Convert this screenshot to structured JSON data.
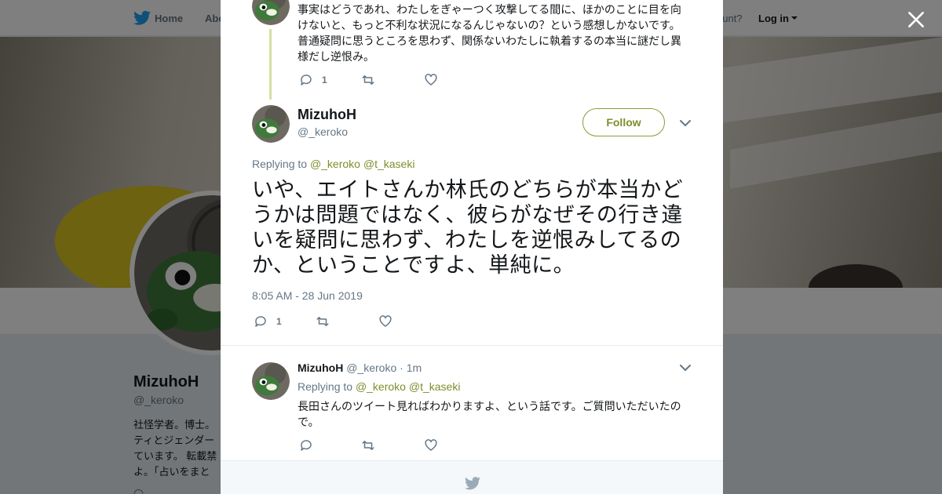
{
  "nav": {
    "home": "Home",
    "about": "Abo",
    "account_prompt": "ccount?",
    "login": "Log in"
  },
  "profile": {
    "name": "MizuhoH",
    "handle": "@_keroko",
    "bio": "社怪学者。博士。ティとジェンダーています。 転載禁よ。「占いをまと",
    "more": "〇 ..."
  },
  "previous_tweet": {
    "text": "事実はどうであれ、わたしをぎゃーつく攻撃してる間に、ほかのことに目を向けないと、もっと不利な状況になるんじゃないの？という感想しかないです。普通疑問に思うところを思わず、関係ないわたしに執着するの本当に謎だし異様だし逆恨み。",
    "reply_count": "1"
  },
  "main_tweet": {
    "name": "MizuhoH",
    "handle": "@_keroko",
    "follow_label": "Follow",
    "replying_prefix": "Replying to",
    "mention1": "@_keroko",
    "mention2": "@t_kaseki",
    "text": "いや、エイトさんか林氏のどちらが本当かどうかは問題ではなく、彼らがなぜその行き違いを疑問に思わず、わたしを逆恨みしてるのか、ということですよ、単純に。",
    "timestamp": "8:05 AM - 28 Jun 2019",
    "reply_count": "1"
  },
  "reply_tweet": {
    "name": "MizuhoH",
    "handle": "@_keroko",
    "age": "· 1m",
    "replying_prefix": "Replying to",
    "mention1": "@_keroko",
    "mention2": "@t_kaseki",
    "text": "長田さんのツイート見ればわかりますよ、という話です。ご質問いただいたので。"
  },
  "colors": {
    "accent_green": "#7d8f2c",
    "twitter_blue": "#1da1f2",
    "thread_line": "#d4e0a1"
  }
}
